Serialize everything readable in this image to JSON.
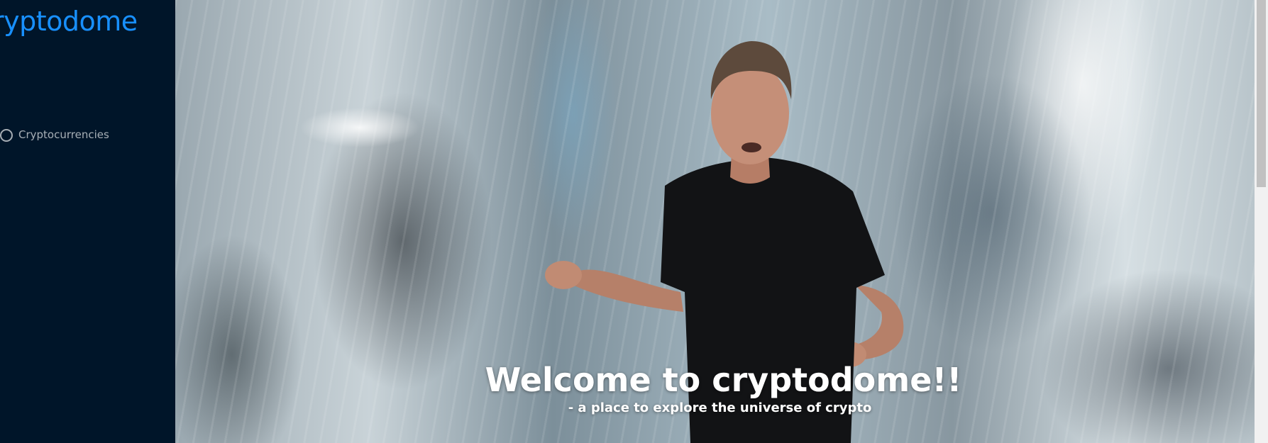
{
  "sidebar": {
    "logo_text": "Cryptodome",
    "nav": [
      {
        "label": "Cryptocurrencies",
        "icon": "fund-icon"
      }
    ]
  },
  "hero": {
    "title": "Welcome to cryptodome!!",
    "subtitle": "- a place to explore the universe of crypto"
  },
  "colors": {
    "sidebar_bg": "#001529",
    "accent": "#1890ff",
    "nav_text": "rgba(255,255,255,0.65)"
  }
}
